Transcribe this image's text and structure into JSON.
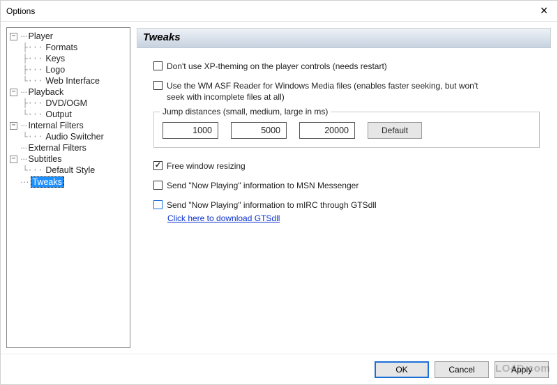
{
  "window": {
    "title": "Options"
  },
  "tree": {
    "groups": [
      {
        "label": "Player",
        "children": [
          "Formats",
          "Keys",
          "Logo",
          "Web Interface"
        ]
      },
      {
        "label": "Playback",
        "children": [
          "DVD/OGM",
          "Output"
        ]
      },
      {
        "label": "Internal Filters",
        "children": [
          "Audio Switcher"
        ]
      },
      {
        "label": "External Filters",
        "children": []
      },
      {
        "label": "Subtitles",
        "children": [
          "Default Style"
        ]
      }
    ],
    "selected_leaf": "Tweaks"
  },
  "panel": {
    "header": "Tweaks",
    "xp_theming": {
      "checked": false,
      "label": "Don't use XP-theming on the player controls (needs restart)"
    },
    "wm_asf": {
      "checked": false,
      "label": "Use the WM ASF Reader for Windows Media files (enables faster seeking, but won't seek with incomplete files at all)"
    },
    "jump": {
      "legend": "Jump distances (small, medium, large in ms)",
      "small": "1000",
      "medium": "5000",
      "large": "20000",
      "default_btn": "Default"
    },
    "free_resize": {
      "checked": true,
      "label": "Free window resizing"
    },
    "msn": {
      "checked": false,
      "label": "Send \"Now Playing\" information to MSN Messenger"
    },
    "mirc": {
      "checked": false,
      "label": "Send \"Now Playing\" information to mIRC through GTSdll"
    },
    "download_link": "Click here to download GTSdll"
  },
  "footer": {
    "ok": "OK",
    "cancel": "Cancel",
    "apply": "Apply"
  },
  "watermark": "LO4D.com"
}
